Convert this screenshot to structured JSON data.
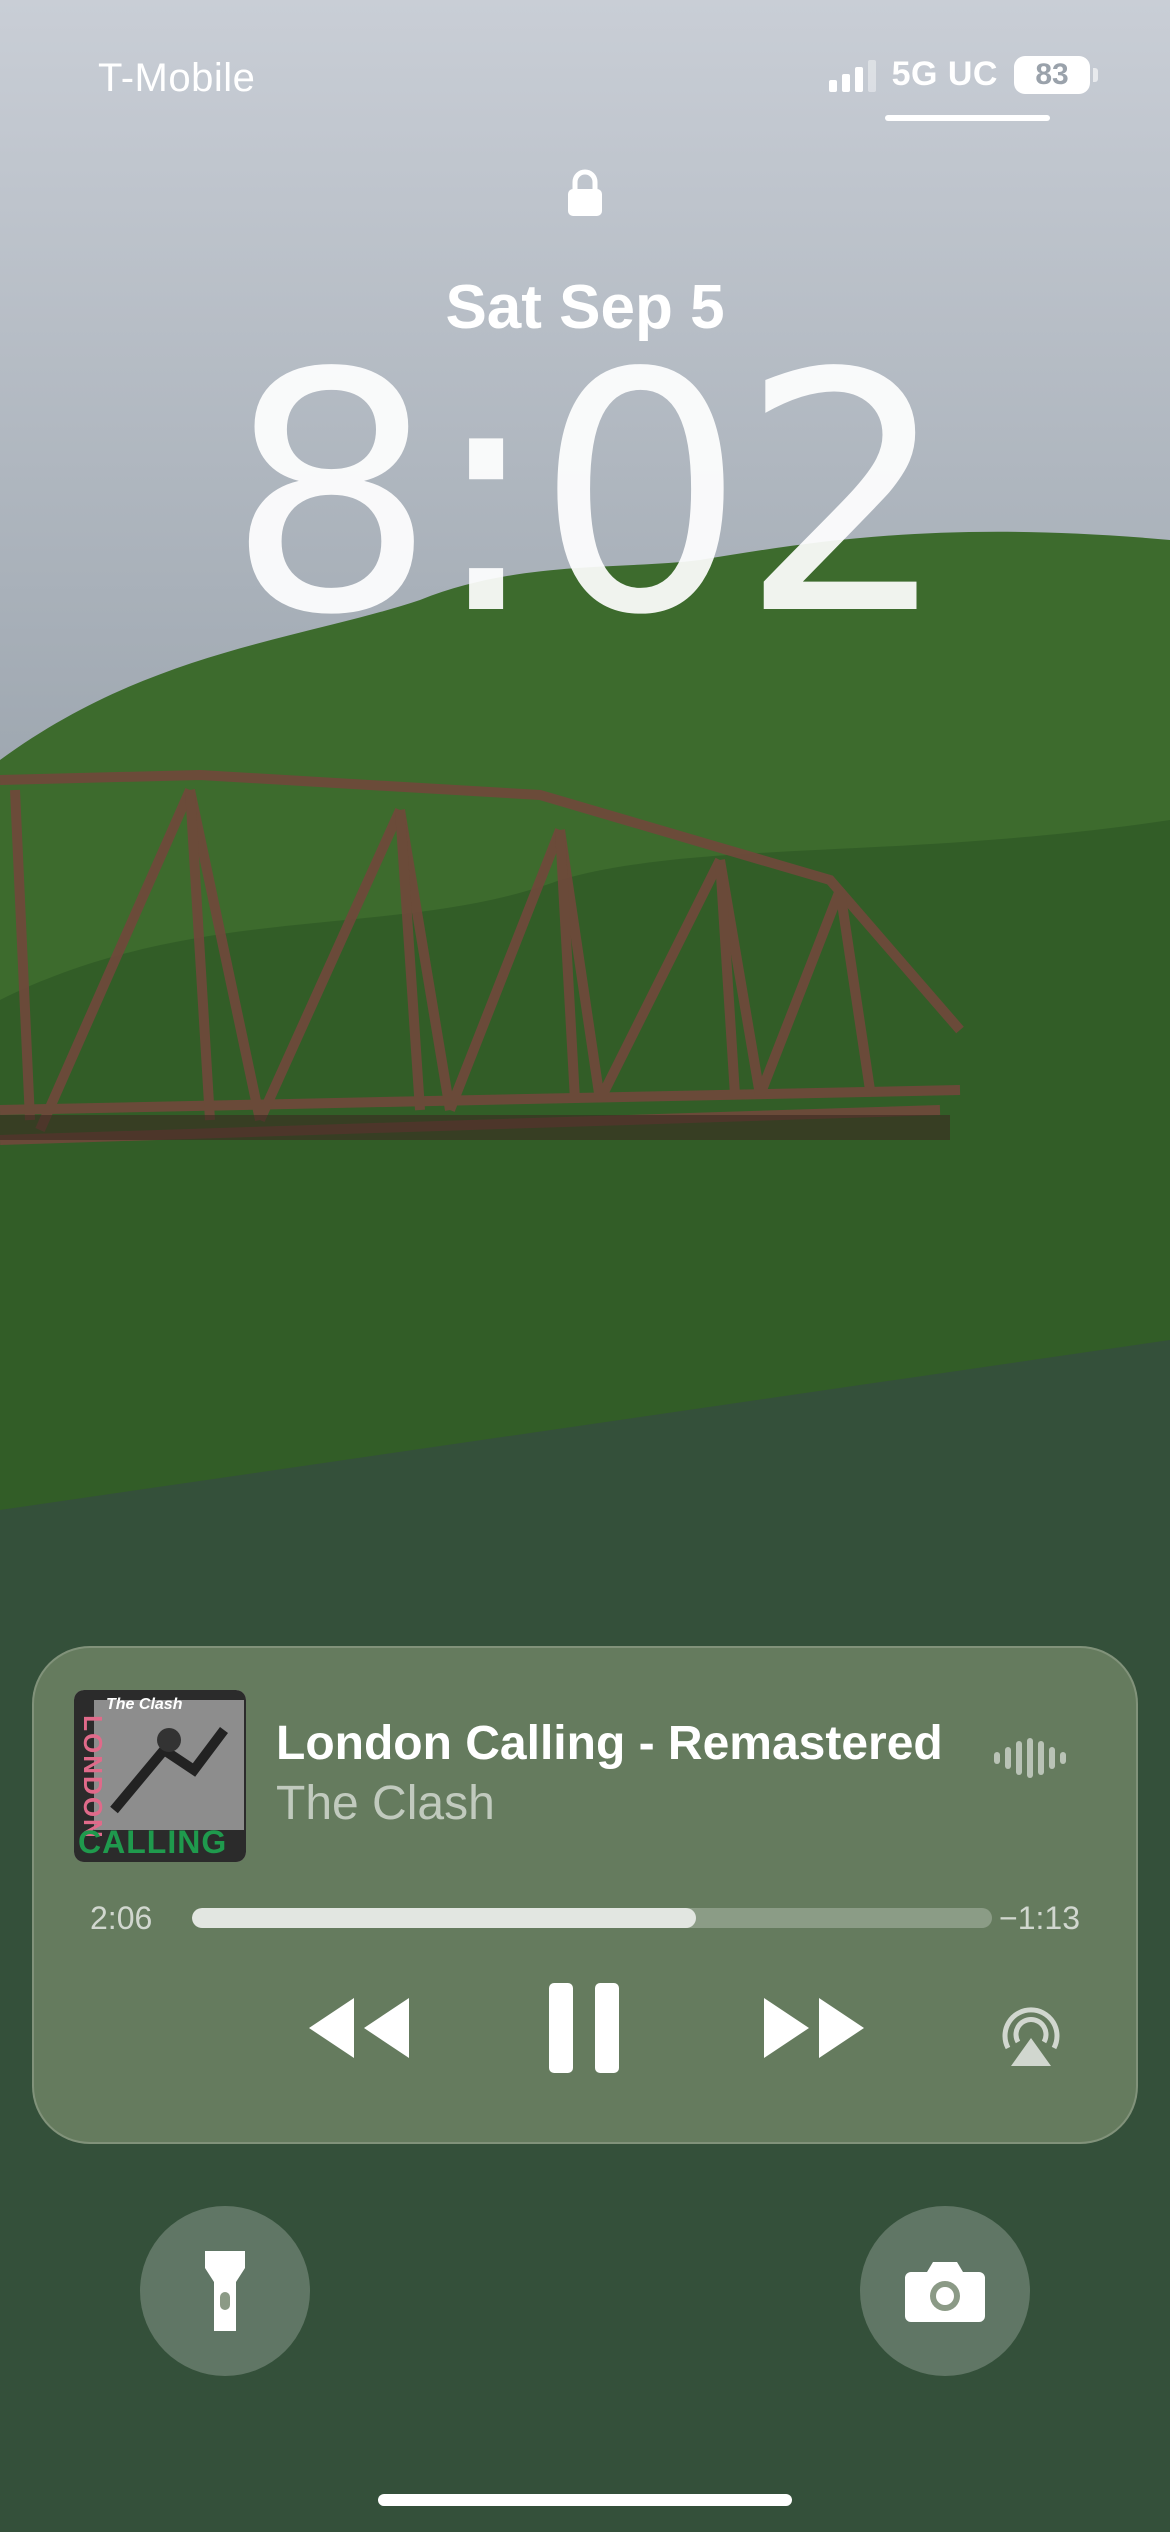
{
  "status_bar": {
    "carrier": "T-Mobile",
    "network": "5G UC",
    "battery": "83"
  },
  "lock_screen": {
    "date": "Sat Sep 5",
    "time": "8:02"
  },
  "now_playing": {
    "title": "London Calling - Remastered",
    "artist": "The Clash",
    "elapsed": "2:06",
    "remaining": "−1:13",
    "progress": 0.63,
    "album_art": {
      "top_text": "The Clash",
      "side_text": "LONDON",
      "bottom_text": "CALLING"
    }
  },
  "icons": {
    "lock": "lock-icon",
    "signal": "cellular-signal-icon",
    "battery": "battery-icon",
    "waveform": "audio-waveform-icon",
    "rewind": "rewind-icon",
    "pause": "pause-icon",
    "forward": "fast-forward-icon",
    "airplay": "airplay-icon",
    "flashlight": "flashlight-icon",
    "camera": "camera-icon"
  },
  "colors": {
    "text": "#ffffff",
    "player_bg": "#788c6c",
    "album_pink": "#e06a8a",
    "album_green": "#1f9a4d"
  }
}
